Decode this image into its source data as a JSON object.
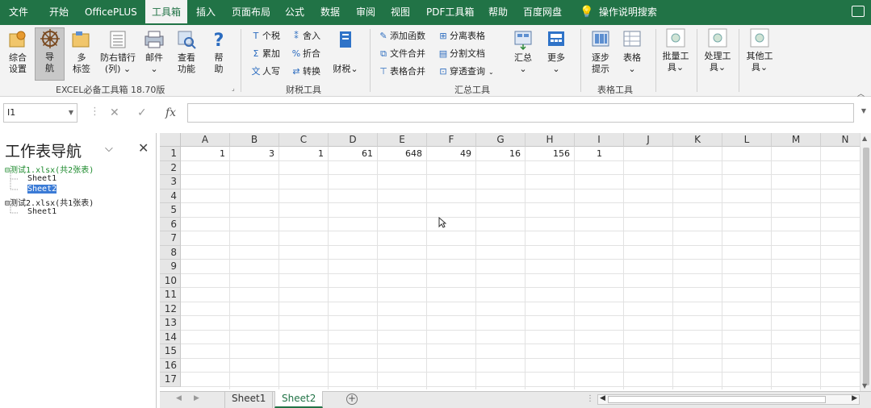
{
  "menu": {
    "tabs": [
      "文件",
      "开始",
      "OfficePLUS",
      "工具箱",
      "插入",
      "页面布局",
      "公式",
      "数据",
      "审阅",
      "视图",
      "PDF工具箱",
      "帮助",
      "百度网盘"
    ],
    "active_tab": "工具箱",
    "search_label": "操作说明搜索"
  },
  "ribbon": {
    "big_buttons": {
      "summary_settings": "综合\n设置",
      "navigation": "导\n航",
      "multi_tabs": "多\n标签",
      "anti_misalign": "防右错行\n(列) ⌄",
      "mail": "邮件\n⌄",
      "view_function": "查看\n功能",
      "help": "帮\n助"
    },
    "group_toolbox_label": "EXCEL必备工具箱 18.70版",
    "finance": {
      "items": [
        "个税",
        "舍入",
        "累加",
        "折合",
        "人写",
        "转换"
      ],
      "finance_dd": "财税⌄",
      "label": "财税工具"
    },
    "summary": {
      "items": [
        "添加函数",
        "分离表格",
        "文件合并",
        "分割文档",
        "表格合并",
        "穿透查询"
      ],
      "summarize": "汇总\n⌄",
      "more": "更多\n⌄",
      "label": "汇总工具"
    },
    "table": {
      "step_hint": "逐步\n提示",
      "table": "表格\n⌄",
      "label": "表格工具"
    },
    "batch": "批量工\n具⌄",
    "process": "处理工\n具⌄",
    "other": "其他工\n具⌄"
  },
  "formula_bar": {
    "name_box": "I1",
    "cancel": "✕",
    "enter": "✓",
    "fx": "fx",
    "value": ""
  },
  "navigator": {
    "title": "工作表导航",
    "tree": [
      {
        "label": "测试1.xlsx(共2张表)",
        "level": 0
      },
      {
        "label": "Sheet1",
        "level": 1
      },
      {
        "label": "Sheet2",
        "level": 1,
        "selected": true
      },
      {
        "label": "测试2.xlsx(共1张表)",
        "level": 0
      },
      {
        "label": "Sheet1",
        "level": 1
      }
    ]
  },
  "grid": {
    "columns": [
      "A",
      "B",
      "C",
      "D",
      "E",
      "F",
      "G",
      "H",
      "I",
      "J",
      "K",
      "L",
      "M",
      "N"
    ],
    "rows": [
      "1",
      "2",
      "3",
      "4",
      "5",
      "6",
      "7",
      "8",
      "9",
      "10",
      "11",
      "12",
      "13",
      "14",
      "15",
      "16",
      "17"
    ],
    "row1": {
      "A": "1",
      "B": "3",
      "C": "1",
      "D": "61",
      "E": "648",
      "F": "49",
      "G": "16",
      "H": "156",
      "I": "1"
    }
  },
  "sheets": {
    "tabs": [
      "Sheet1",
      "Sheet2"
    ],
    "active": "Sheet2"
  }
}
